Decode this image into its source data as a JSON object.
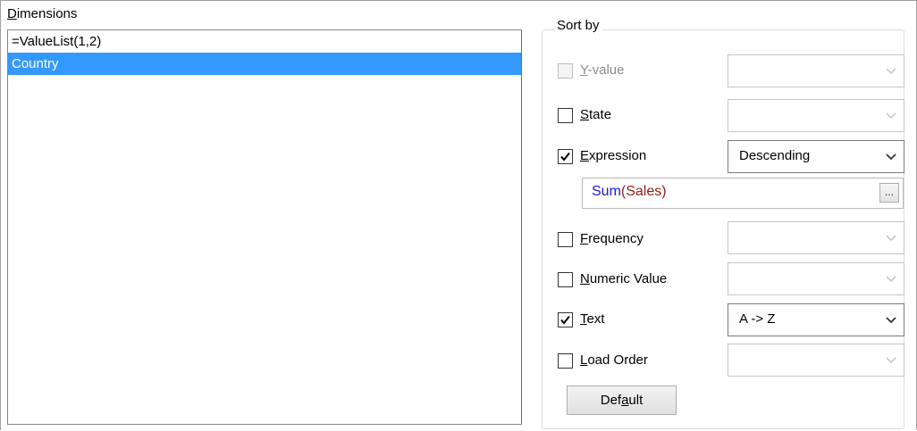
{
  "dimensions": {
    "label": "Dimensions",
    "items": [
      {
        "text": "=ValueList(1,2)",
        "selected": false
      },
      {
        "text": "Country",
        "selected": true
      }
    ]
  },
  "sort_by": {
    "title": "Sort by",
    "options": {
      "y_value": {
        "label": "Y-value",
        "checked": false,
        "enabled": false,
        "dropdown": ""
      },
      "state": {
        "label": "State",
        "checked": false,
        "enabled": true,
        "dropdown": ""
      },
      "expression": {
        "label": "Expression",
        "checked": true,
        "enabled": true,
        "dropdown": "Descending"
      },
      "frequency": {
        "label": "Frequency",
        "checked": false,
        "enabled": true,
        "dropdown": ""
      },
      "numeric_value": {
        "label": "Numeric Value",
        "checked": false,
        "enabled": true,
        "dropdown": ""
      },
      "text": {
        "label": "Text",
        "checked": true,
        "enabled": true,
        "dropdown": "A -> Z"
      },
      "load_order": {
        "label": "Load Order",
        "checked": false,
        "enabled": true,
        "dropdown": ""
      }
    },
    "expression_formula": {
      "function": "Sum",
      "open": "(",
      "argument": "Sales",
      "close": ")"
    },
    "browse_label": "...",
    "default_button": "Default"
  },
  "colors": {
    "selection": "#3399ff",
    "formula_function": "#1a1ad6",
    "formula_argument": "#9a1a1a"
  },
  "icons": {
    "check": "checkmark-icon",
    "dropdown": "chevron-down-icon"
  }
}
